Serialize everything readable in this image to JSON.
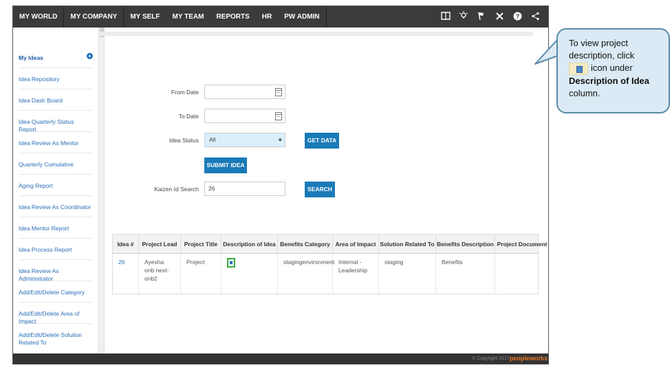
{
  "nav": {
    "items": [
      "MY WORLD",
      "MY COMPANY",
      "MY SELF",
      "MY TEAM",
      "REPORTS",
      "HR",
      "PW ADMIN"
    ],
    "icons": [
      "book-icon",
      "lightbulb-icon",
      "flag-icon",
      "tools-icon",
      "help-icon",
      "share-icon"
    ]
  },
  "sidebar": {
    "plus": "+",
    "items": [
      "My Ideas",
      "Idea Repository",
      "Idea Dash Board",
      "Idea Quarterly Status Report",
      "Idea Review As Mentor",
      "Quarterly Cumulative",
      "Aging Report",
      "Idea Review As Coordinator",
      "Idea Mentor Report",
      "Idea Process Report",
      "Idea Review As Administrator",
      "Add/Edit/Delete Category",
      "Add/Edit/Delete Area of Impact",
      "Add/Edit/Delete Solution Related To"
    ]
  },
  "form": {
    "from_date_label": "From Date",
    "to_date_label": "To Date",
    "idea_status_label": "Idea Status",
    "idea_status_value": "All",
    "get_data_label": "GET DATA",
    "submit_idea_label": "SUBMIT IDEA",
    "kaizen_label": "Kaizen Id Search",
    "kaizen_value": "26",
    "search_label": "SEARCH"
  },
  "table": {
    "headers": [
      "Idea #",
      "Project Lead",
      "Project Title",
      "Description of Idea",
      "Benefits Category",
      "Area of Impact",
      "Solution Related To",
      "Benefits Description",
      "Project Document"
    ],
    "row": {
      "idea_no": "26",
      "lead": "Ayesha onb next-onb2",
      "title": "Project",
      "benefits_category": "stagingenvironment",
      "area_of_impact": "Internal - Leadership",
      "solution_related_to": "staging",
      "benefits_description": "Benefits",
      "project_document": ""
    }
  },
  "footer": {
    "copyright": "© Copyright 2017",
    "brand": "peopleworks"
  },
  "callout": {
    "line1": "To view project description, click",
    "line2": "icon under",
    "bold1": "Description of Idea",
    "line3": "column."
  }
}
